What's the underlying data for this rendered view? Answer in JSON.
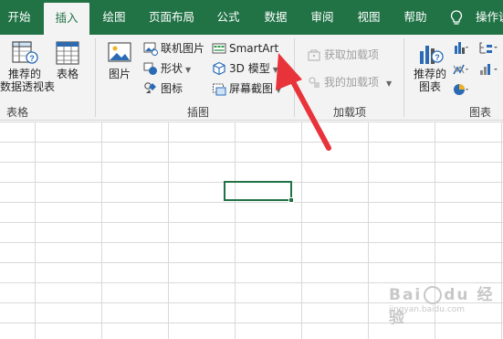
{
  "tabs": [
    {
      "label": "开始"
    },
    {
      "label": "插入"
    },
    {
      "label": "绘图"
    },
    {
      "label": "页面布局"
    },
    {
      "label": "公式"
    },
    {
      "label": "数据"
    },
    {
      "label": "审阅"
    },
    {
      "label": "视图"
    },
    {
      "label": "帮助"
    }
  ],
  "tell_me": "操作说",
  "groups": {
    "tables": {
      "label": "表格",
      "pivot_recommended": [
        "推荐的",
        "数据透视表"
      ],
      "table": "表格"
    },
    "illustrations": {
      "label": "插图",
      "pictures": "图片",
      "online_pictures": "联机图片",
      "shapes": "形状",
      "icons": "图标",
      "smartart": "SmartArt",
      "model3d": "3D 模型",
      "screenshot": "屏幕截图"
    },
    "addins": {
      "label": "加载项",
      "get_addins": "获取加载项",
      "my_addins": "我的加载项"
    },
    "charts": {
      "label": "图表",
      "recommended": [
        "推荐的",
        "图表"
      ]
    }
  },
  "colors": {
    "accent": "#217346",
    "arrow": "#e8333a"
  },
  "watermark": [
    "Bai",
    "du",
    "经验"
  ],
  "watermark_sub": "jingyan.baidu.com"
}
